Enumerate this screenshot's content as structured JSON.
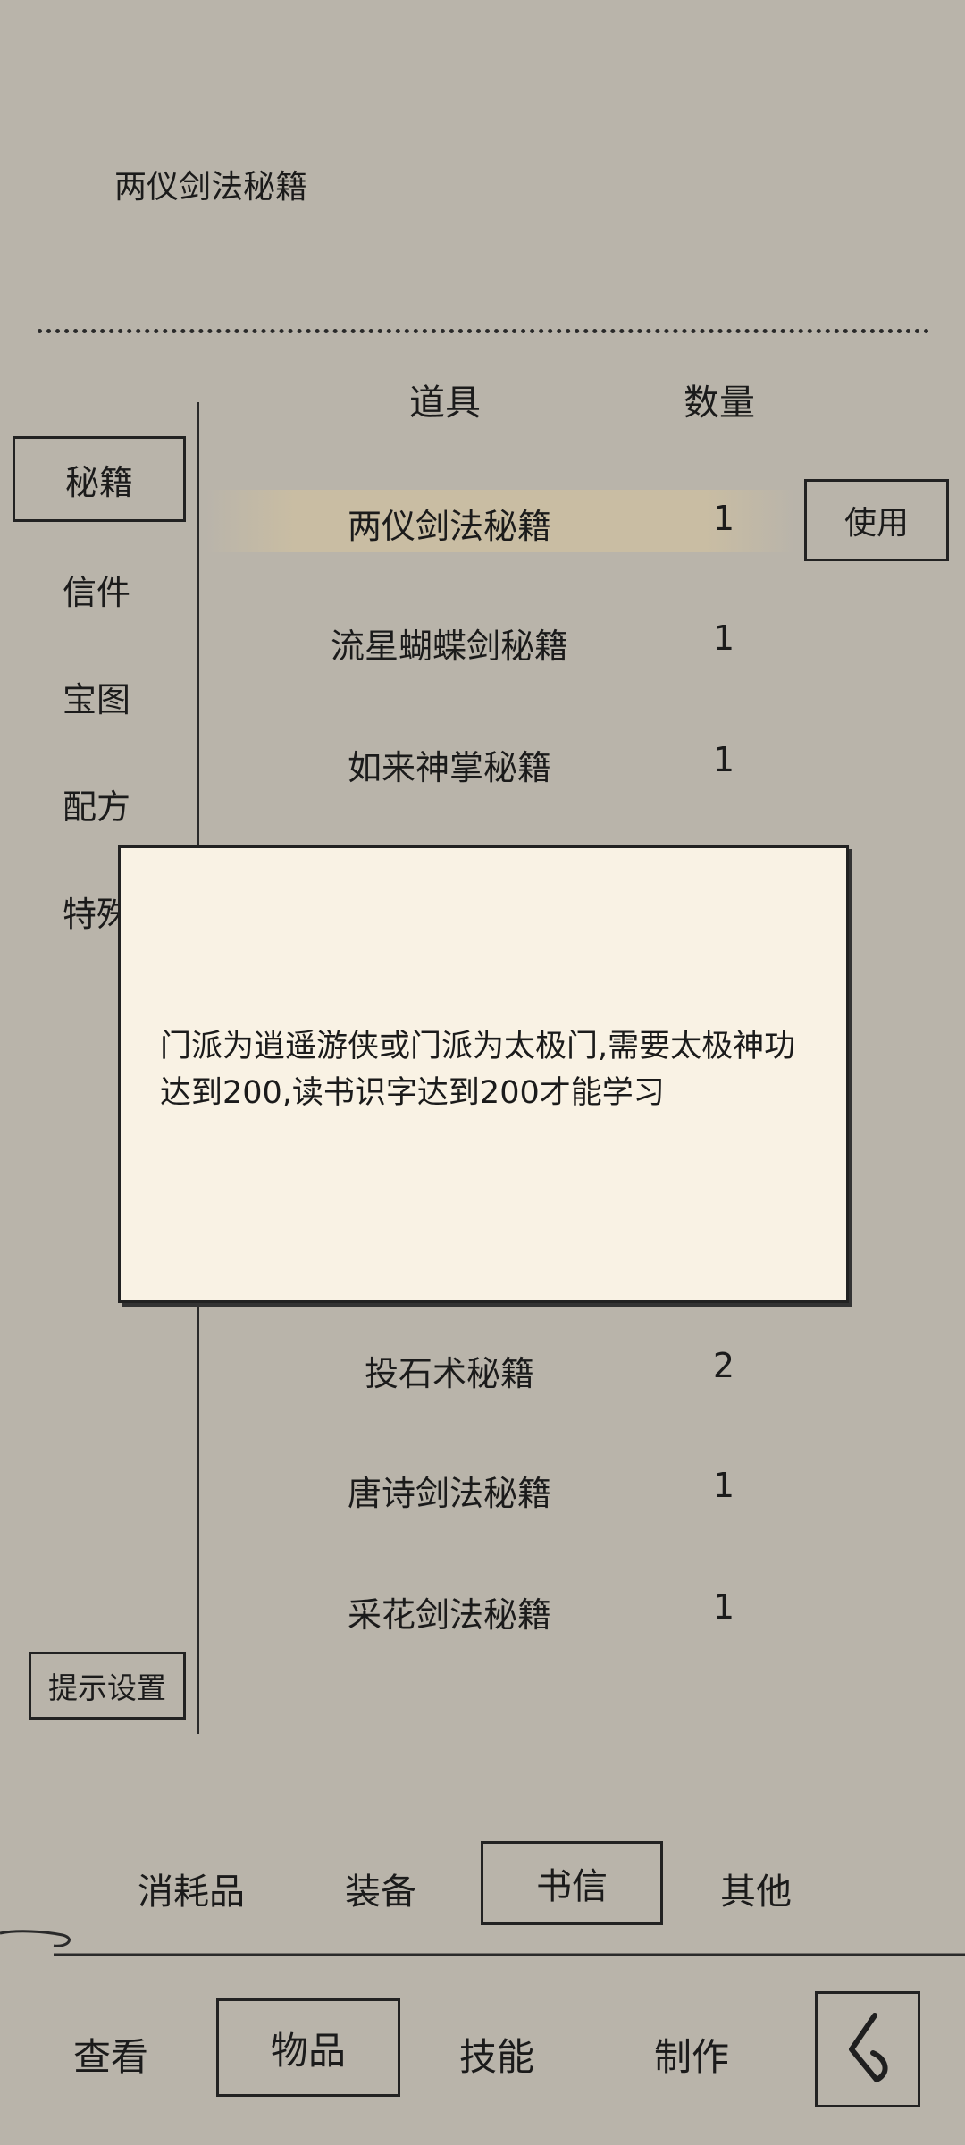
{
  "header": {
    "title": "两仪剑法秘籍"
  },
  "columns": {
    "item": "道具",
    "quantity": "数量"
  },
  "sidebar": {
    "items": [
      {
        "label": "秘籍",
        "selected": true
      },
      {
        "label": "信件"
      },
      {
        "label": "宝图"
      },
      {
        "label": "配方"
      },
      {
        "label": "特殊"
      }
    ],
    "tip_settings": "提示设置"
  },
  "items": [
    {
      "name": "两仪剑法秘籍",
      "qty": "1"
    },
    {
      "name": "流星蝴蝶剑秘籍",
      "qty": "1"
    },
    {
      "name": "如来神掌秘籍",
      "qty": "1"
    },
    {
      "name": "投石术秘籍",
      "qty": "2"
    },
    {
      "name": "唐诗剑法秘籍",
      "qty": "1"
    },
    {
      "name": "采花剑法秘籍",
      "qty": "1"
    }
  ],
  "use_button": "使用",
  "modal": {
    "text": "门派为逍遥游侠或门派为太极门,需要太极神功达到200,读书识字达到200才能学习"
  },
  "categories": [
    {
      "label": "消耗品"
    },
    {
      "label": "装备"
    },
    {
      "label": "书信",
      "selected": true
    },
    {
      "label": "其他"
    }
  ],
  "nav": [
    {
      "label": "查看"
    },
    {
      "label": "物品",
      "selected": true
    },
    {
      "label": "技能"
    },
    {
      "label": "制作"
    }
  ],
  "icons": {
    "back": "back-arrow-icon"
  },
  "colors": {
    "background": "#b9b4aa",
    "modal_bg": "#f9f2e4",
    "highlight": "#c9bda3"
  }
}
